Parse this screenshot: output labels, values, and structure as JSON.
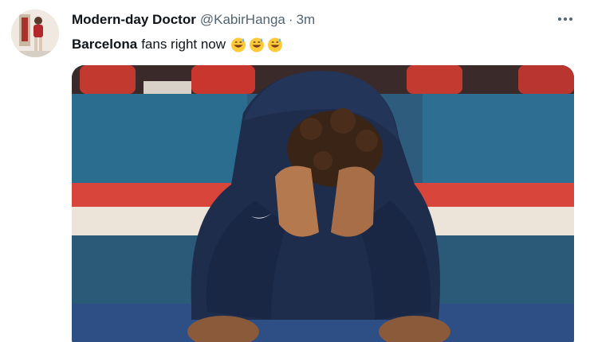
{
  "tweet": {
    "author": {
      "display_name": "Modern-day Doctor",
      "handle": "@KabirHanga",
      "separator": "·",
      "timestamp": "3m"
    },
    "text": {
      "bold_part": "Barcelona",
      "rest": "fans right now",
      "emoji": [
        "grinning-sweat-emoji",
        "grinning-sweat-emoji",
        "grinning-sweat-emoji"
      ]
    },
    "media": {
      "type": "photo",
      "subject": "player-hiding-face-photo"
    },
    "icons": {
      "more": "more-options-icon"
    },
    "colors": {
      "text_primary": "#0f1419",
      "text_secondary": "#536471",
      "bench_blue": "#2d5c7d",
      "bench_red": "#d8453a",
      "jacket_navy": "#1f2d4d"
    }
  }
}
